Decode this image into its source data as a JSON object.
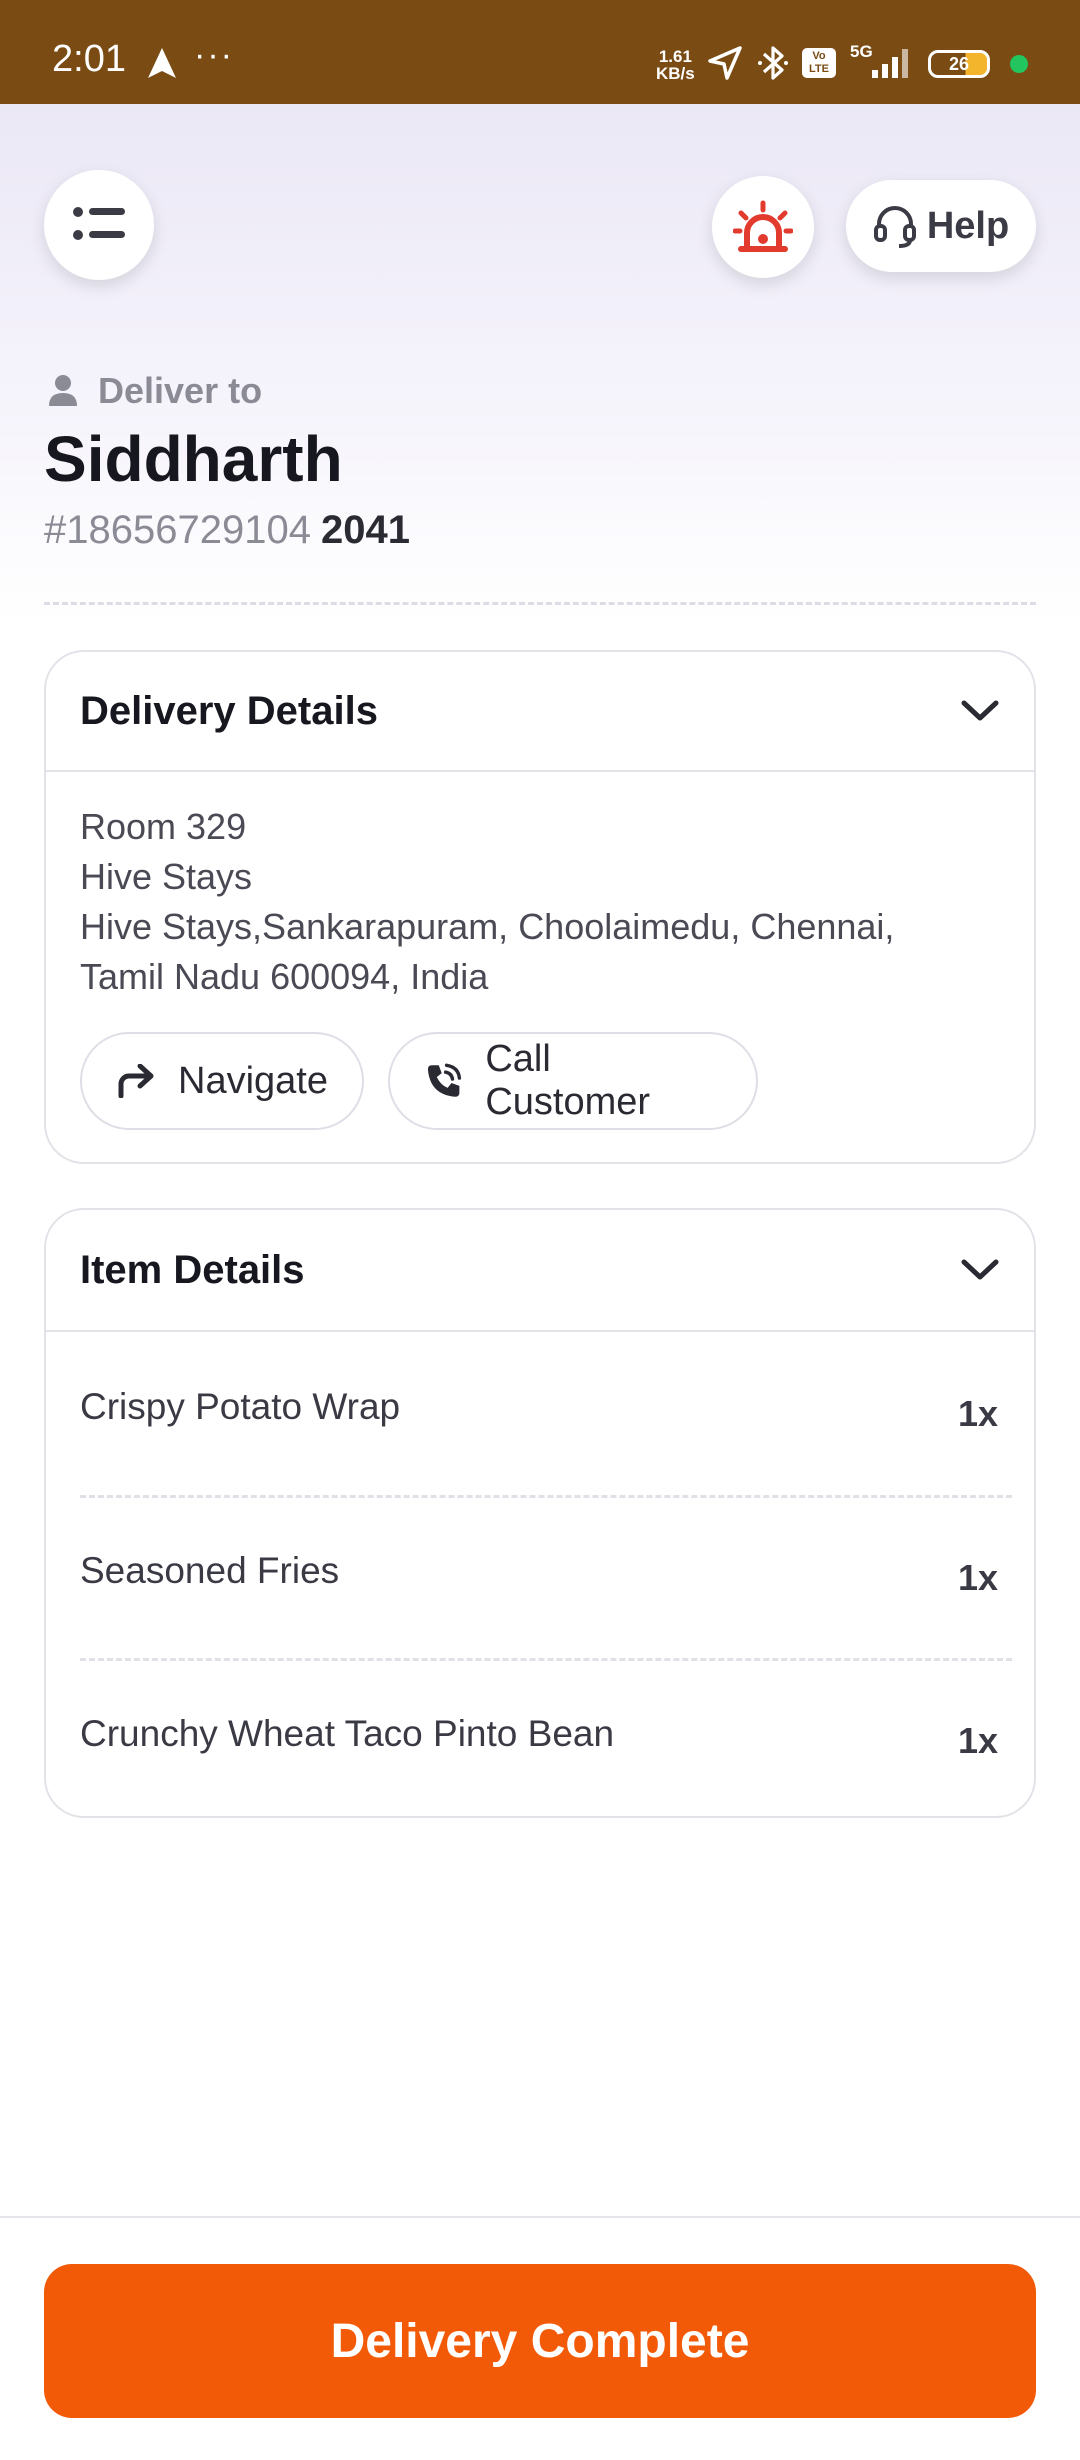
{
  "status_bar": {
    "time": "2:01",
    "more": "···",
    "speed_value": "1.61",
    "speed_unit": "KB/s",
    "network": "5G",
    "volte": "Vo LTE",
    "battery": "26"
  },
  "header": {
    "help_label": "Help"
  },
  "delivery": {
    "deliver_to_label": "Deliver to",
    "customer_name": "Siddharth",
    "order_number": "#18656729104",
    "order_code": "2041"
  },
  "delivery_details": {
    "title": "Delivery Details",
    "address_lines": [
      "Room 329",
      "Hive Stays",
      "Hive Stays,Sankarapuram, Choolaimedu, Chennai,",
      "Tamil Nadu 600094, India"
    ],
    "navigate_label": "Navigate",
    "call_label": "Call Customer"
  },
  "item_details": {
    "title": "Item Details",
    "items": [
      {
        "name": "Crispy Potato Wrap",
        "qty": "1x"
      },
      {
        "name": "Seasoned Fries",
        "qty": "1x"
      },
      {
        "name": "Crunchy Wheat Taco Pinto Bean",
        "qty": "1x"
      }
    ]
  },
  "footer": {
    "complete_label": "Delivery Complete"
  },
  "colors": {
    "status_bar": "#7a4c14",
    "accent": "#f25a08",
    "sos_red": "#e23b2e"
  }
}
